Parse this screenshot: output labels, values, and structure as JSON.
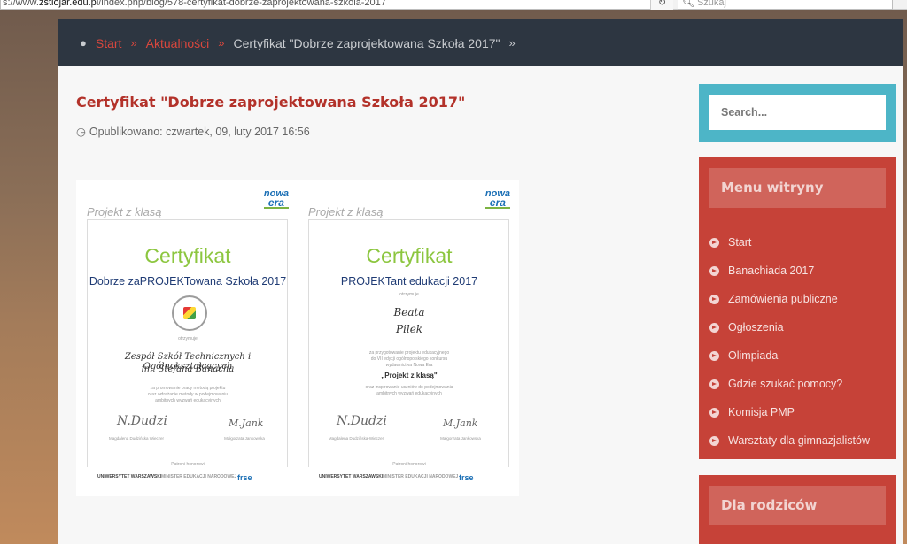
{
  "browser": {
    "url_prefix": "s://www.",
    "url_host": "zstiojar.edu.pl",
    "url_path": "/index.php/blog/578-certyfikat-dobrze-zaprojektowana-szkola-2017",
    "reload_icon": "reload-icon",
    "search_placeholder": "Szukaj"
  },
  "breadcrumb": {
    "pin_icon": "map-pin-icon",
    "items": [
      "Start",
      "Aktualności"
    ],
    "current": "Certyfikat \"Dobrze zaprojektowana Szkoła 2017\"",
    "separator": "»"
  },
  "article": {
    "title": "Certyfikat \"Dobrze zaprojektowana Szkoła 2017\"",
    "meta_label": "Opublikowano: czwartek, 09, luty 2017 16:56",
    "image": {
      "left": {
        "project_logo": "Projekt z klasą",
        "brand_line1": "nowa",
        "brand_line2": "era",
        "heading": "Certyfikat",
        "subtitle": "Dobrze zaPROJEKTowana Szkoła 2017",
        "receiver_label": "otrzymuje",
        "name_line1": "Zespół Szkół Technicznych i Ogólnokształcących",
        "name_line2": "im. Stefana Banacha",
        "body_line1": "za promowanie pracy metodą projektu",
        "body_line2": "oraz wdrażanie metody w podejmowaniu",
        "body_line3": "ambitnych wyzwań edukacyjnych",
        "sig1_caption": "Magdalena Dudzińska Wieczer",
        "sig2_caption": "Małgorzata Jankowska",
        "patrons_label": "Patroni honorowi",
        "partner1": "UNIWERSYTET WARSZAWSKI",
        "partner2": "MINISTER EDUKACJI NARODOWEJ",
        "partner3": "frse"
      },
      "right": {
        "project_logo": "Projekt z klasą",
        "brand_line1": "nowa",
        "brand_line2": "era",
        "heading": "Certyfikat",
        "subtitle": "PROJEKTant edukacji 2017",
        "receiver_label": "otrzymuje",
        "name_line1": "Beata",
        "name_line2": "Pilek",
        "body_line1": "za przygotowanie projektu edukacyjnego",
        "body_line2": "do VII edycji ogólnopolskiego konkursu",
        "body_line3": "wydawnictwa Nowa Era",
        "program_title": "„Projekt z klasą\"",
        "body_line4": "oraz inspirowanie uczniów do podejmowania",
        "body_line5": "ambitnych wyzwań edukacyjnych",
        "sig1_caption": "Magdalena Dudzińska-Wieczer",
        "sig2_caption": "Małgorzata Jankowska",
        "patrons_label": "Patroni honorowi",
        "partner1": "UNIWERSYTET WARSZAWSKI",
        "partner2": "MINISTER EDUKACJI NARODOWEJ",
        "partner3": "frse"
      }
    }
  },
  "sidebar": {
    "search_placeholder": "Search...",
    "menu_title": "Menu witryny",
    "menu_items": [
      "Start",
      "Banachiada 2017",
      "Zamówienia publiczne",
      "Ogłoszenia",
      "Olimpiada",
      "Gdzie szukać pomocy?",
      "Komisja PMP",
      "Warsztaty dla gimnazjalistów"
    ],
    "parents_title": "Dla rodziców"
  },
  "colors": {
    "accent_red": "#c64238",
    "accent_teal": "#4db5c7",
    "breadcrumb_bg": "#2d3641",
    "title_red": "#b3322a"
  }
}
